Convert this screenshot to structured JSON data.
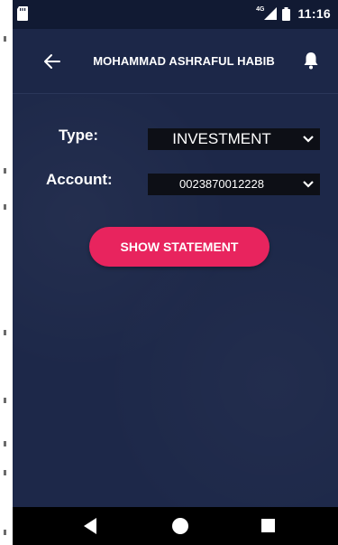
{
  "status_bar": {
    "network": "4G",
    "time": "11:16",
    "icons": [
      "sd-card-icon",
      "signal-icon",
      "battery-icon"
    ]
  },
  "app_bar": {
    "title": "MOHAMMAD ASHRAFUL HABIB",
    "back_icon": "arrow-left-icon",
    "notification_icon": "bell-icon"
  },
  "form": {
    "type": {
      "label": "Type:",
      "value": "INVESTMENT"
    },
    "account": {
      "label": "Account:",
      "value": "0023870012228"
    }
  },
  "actions": {
    "show_statement_label": "SHOW STATEMENT"
  },
  "colors": {
    "background": "#1d2849",
    "accent": "#e8245e",
    "select_bg": "#0d0f16"
  },
  "nav_bar": {
    "icons": [
      "triangle-back-icon",
      "circle-home-icon",
      "square-recents-icon"
    ]
  }
}
